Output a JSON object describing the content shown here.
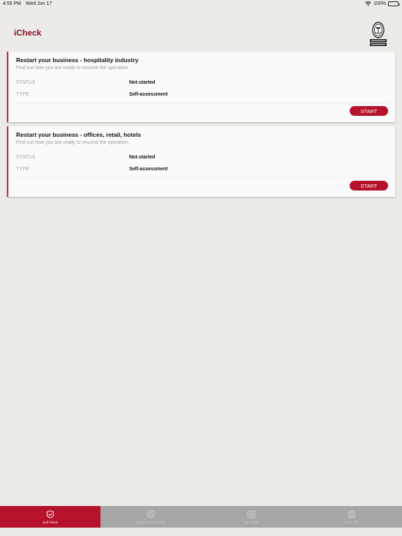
{
  "status_bar": {
    "time": "4:55 PM",
    "date": "Wed Jun 17",
    "battery": "100%",
    "wifi_icon": "wifi-icon",
    "battery_icon": "battery-icon"
  },
  "header": {
    "title": "iCheck",
    "logo_icon": "bureau-veritas-logo"
  },
  "cards": [
    {
      "title": "Restart your business - hospitality industry",
      "subtitle": "Find out how you are ready to resume the operation",
      "status_label": "STATUS",
      "status_value": "Not-started",
      "type_label": "TYPE",
      "type_value": "Self-assessment",
      "button": "START"
    },
    {
      "title": "Restart your business - offices, retail, hotels",
      "subtitle": "Find out how you are ready to resume the operation",
      "status_label": "STATUS",
      "status_value": "Not-started",
      "type_label": "TYPE",
      "type_value": "Self-assessment",
      "button": "START"
    }
  ],
  "tabs": [
    {
      "label": "Self Check",
      "icon": "shield-check-icon",
      "active": true
    },
    {
      "label": "Bureau Veritas Verify",
      "icon": "shield-badge-icon",
      "active": false
    },
    {
      "label": "My Activity",
      "icon": "list-icon",
      "active": false
    },
    {
      "label": "My Profile",
      "icon": "profile-icon",
      "active": false
    }
  ],
  "colors": {
    "accent": "#b5122c",
    "title": "#8a1122",
    "background": "#ecebe7",
    "tabbar": "#a7a7a7"
  }
}
